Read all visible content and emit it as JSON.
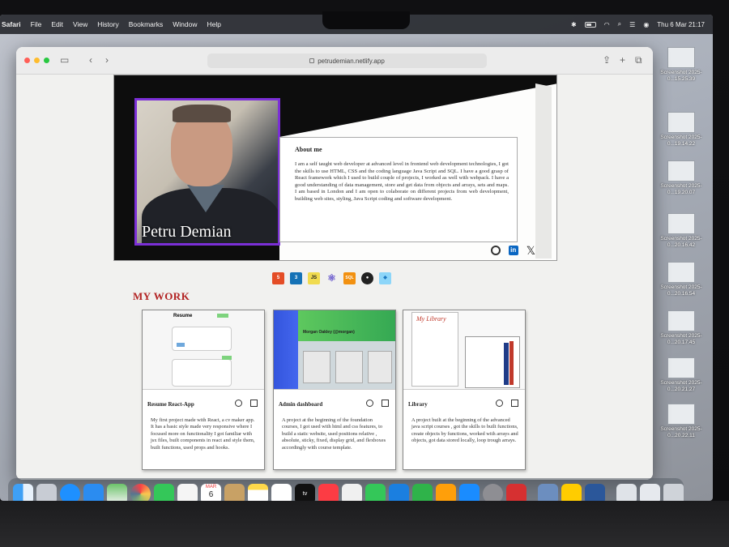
{
  "menubar": {
    "app": "Safari",
    "menus": [
      "File",
      "Edit",
      "View",
      "History",
      "Bookmarks",
      "Window",
      "Help"
    ],
    "clock": "Thu 6 Mar  21:17"
  },
  "desktop": {
    "icons": [
      {
        "label": "Screenshot 2025-0...15.25.39"
      },
      {
        "label": "Screenshot 2025-0...19.14.22"
      },
      {
        "label": "Screenshot 2025-0...19.20.07"
      },
      {
        "label": "Screenshot 2025-0...20.16.42"
      },
      {
        "label": "Screenshot 2025-0...20.16.54"
      },
      {
        "label": "Screenshot 2025-0...20.17.45"
      },
      {
        "label": "Screenshot 2025-0...20.21.27"
      },
      {
        "label": "Screenshot 2025-0...20.22.11"
      }
    ]
  },
  "browser": {
    "url": "petrudemian.netlify.app"
  },
  "hero": {
    "name": "Petru Demian",
    "about_title": "About me",
    "about_text": "I am a self taught web developer at advanced level in frontend web development technologies, I got the skills to use HTML, CSS and the coding language Java Script and SQL. I have a good grasp of React framework which I used to build couple of projects, I worked as well with webpack. I have a good understanding of data management, store and get data from objects and arrays, sets and maps. I am based in London and I am open to colaborate on different projects from web development, building web sites, styling, Java Script coding and software development.",
    "social": [
      "github-icon",
      "linkedin-icon",
      "x-icon"
    ]
  },
  "tech_icons": [
    {
      "name": "html5-icon",
      "label": "5",
      "color": "#e44d26"
    },
    {
      "name": "css3-icon",
      "label": "3",
      "color": "#1572b6"
    },
    {
      "name": "javascript-icon",
      "label": "JS",
      "color": "#f0db4f"
    },
    {
      "name": "react-icon",
      "label": "⚛",
      "color": "#6a5acd"
    },
    {
      "name": "sql-icon",
      "label": "SQL",
      "color": "#f29111"
    },
    {
      "name": "github-icon",
      "label": "●",
      "color": "#222222"
    },
    {
      "name": "webpack-icon",
      "label": "◆",
      "color": "#8dd6f9"
    }
  ],
  "section_title": "MY WORK",
  "projects": [
    {
      "title": "Resume React-App",
      "desc": "My first project made with React, a cv maker app. It has a basic style made very responsive where I focused more on functionality I got familiar with jsx files, built components in react and style them, built functions, used props and hooks.",
      "shot_title": "Resume"
    },
    {
      "title": "Admin dashboard",
      "desc": "A project at the beginning of the foundation courses, I got used with html and css features, to build a static website, used positions relative , absolute, sticky, fixed, display grid, and flexboxes accordingly with course template.",
      "shot_title": "Morgan Oakley (@morgan)"
    },
    {
      "title": "Library",
      "desc": "A project built at the beginning of the advanced java script courses , got the skills to built functions, create objects by functions, worked with arrays and objects, got data stored locally, loop trough arrays.",
      "shot_title": "My Library"
    }
  ],
  "dock": {
    "calendar_month": "MAR",
    "calendar_day": "6",
    "apps": [
      "finder-icon",
      "launchpad-icon",
      "safari-icon",
      "mail-icon",
      "maps-icon",
      "photos-icon",
      "facetime-icon",
      "reminders-icon",
      "calendar-icon",
      "contacts-icon",
      "notes-icon",
      "freeform-icon",
      "tv-icon",
      "music-icon",
      "news-icon",
      "messages-icon",
      "keynote-icon",
      "numbers-icon",
      "pages-icon",
      "app-store-icon",
      "system-settings-icon",
      "among-us-icon",
      "preview-icon",
      "tips-icon",
      "word-icon",
      "files-icon",
      "downloads-icon",
      "trash-icon"
    ]
  }
}
